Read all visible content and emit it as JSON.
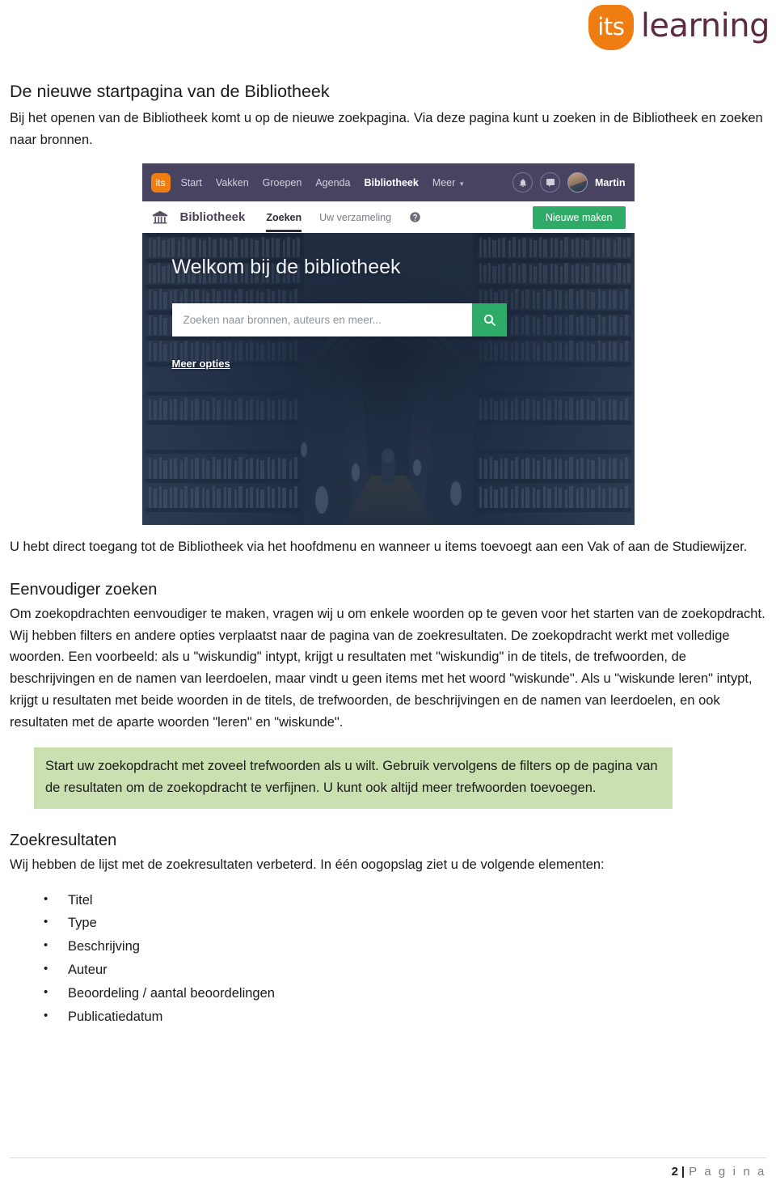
{
  "brand": {
    "mark_text": "its",
    "word": "learning",
    "mark_color": "#f07d12",
    "word_color": "#5d2a42"
  },
  "document": {
    "title": "De nieuwe startpagina van de Bibliotheek",
    "intro": "Bij het openen van de Bibliotheek komt u op de nieuwe zoekpagina. Via deze pagina kunt u zoeken in de Bibliotheek en zoeken naar bronnen.",
    "after_image": "U hebt direct toegang tot de Bibliotheek via het hoofdmenu en wanneer u items toevoegt aan een Vak of aan de Studiewijzer.",
    "section_simple_search": {
      "heading": "Eenvoudiger zoeken",
      "paragraph": "Om zoekopdrachten eenvoudiger te maken, vragen wij u om enkele woorden op te geven voor het starten van de zoekopdracht. Wij hebben filters en andere opties verplaatst naar de pagina van de zoekresultaten. De zoekopdracht werkt met volledige woorden. Een voorbeeld: als u \"wiskundig\" intypt, krijgt u resultaten met \"wiskundig\" in de titels, de trefwoorden, de beschrijvingen en de namen van leerdoelen, maar vindt u geen items met het woord \"wiskunde\". Als u \"wiskunde leren\" intypt, krijgt u resultaten met beide woorden in de titels, de trefwoorden, de beschrijvingen en de namen van leerdoelen, en ook resultaten met de aparte woorden \"leren\" en \"wiskunde\"."
    },
    "callout": {
      "text": "Start uw zoekopdracht met zoveel trefwoorden als u wilt. Gebruik vervolgens de filters op de pagina van de resultaten om de zoekopdracht te verfijnen. U kunt ook altijd meer trefwoorden toevoegen.",
      "background_color": "#cae0b1"
    },
    "section_results": {
      "heading": "Zoekresultaten",
      "paragraph": "Wij hebben de lijst met de zoekresultaten verbeterd. In één oogopslag ziet u de volgende elementen:",
      "items": [
        "Titel",
        "Type",
        "Beschrijving",
        "Auteur",
        "Beoordeling / aantal beoordelingen",
        "Publicatiedatum"
      ]
    }
  },
  "screenshot": {
    "topbar": {
      "logo_text": "its",
      "nav_items": [
        {
          "label": "Start",
          "active": false
        },
        {
          "label": "Vakken",
          "active": false
        },
        {
          "label": "Groepen",
          "active": false
        },
        {
          "label": "Agenda",
          "active": false
        },
        {
          "label": "Bibliotheek",
          "active": true
        },
        {
          "label": "Meer",
          "active": false,
          "caret": true
        }
      ],
      "user_name": "Martin",
      "bg_color": "#474361"
    },
    "subbar": {
      "title": "Bibliotheek",
      "tabs": [
        {
          "label": "Zoeken",
          "active": true
        },
        {
          "label": "Uw verzameling",
          "active": false
        }
      ],
      "new_button": "Nieuwe maken",
      "new_button_color": "#2fab68"
    },
    "hero": {
      "title": "Welkom bij de bibliotheek",
      "search_placeholder": "Zoeken naar bronnen, auteurs en meer...",
      "more_options": "Meer opties"
    }
  },
  "footer": {
    "page_number": "2",
    "separator": "|",
    "label": "P a g i n a"
  }
}
